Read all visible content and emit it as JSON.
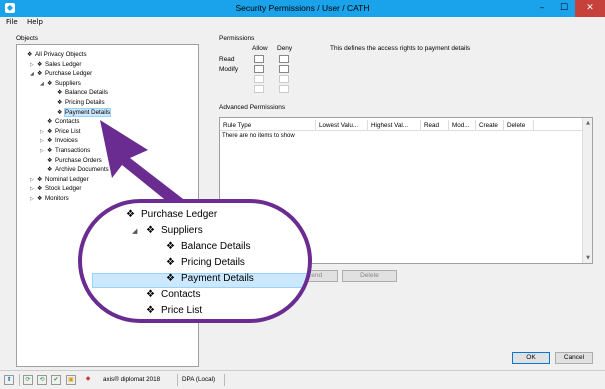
{
  "window": {
    "title": "Security Permissions / User / CATH",
    "app_icon": "axis-icon"
  },
  "menu": {
    "items": [
      "File",
      "Help"
    ]
  },
  "objects": {
    "label": "Objects",
    "tree": [
      {
        "label": "All Privacy Objects",
        "depth": 0,
        "expander": ""
      },
      {
        "label": "Sales Ledger",
        "depth": 1,
        "expander": "▷"
      },
      {
        "label": "Purchase Ledger",
        "depth": 1,
        "expander": "◢"
      },
      {
        "label": "Suppliers",
        "depth": 2,
        "expander": "◢"
      },
      {
        "label": "Balance Details",
        "depth": 3,
        "expander": ""
      },
      {
        "label": "Pricing Details",
        "depth": 3,
        "expander": ""
      },
      {
        "label": "Payment Details",
        "depth": 3,
        "expander": "",
        "selected": true
      },
      {
        "label": "Contacts",
        "depth": 2,
        "expander": ""
      },
      {
        "label": "Price List",
        "depth": 2,
        "expander": "▷"
      },
      {
        "label": "Invoices",
        "depth": 2,
        "expander": "▷"
      },
      {
        "label": "Transactions",
        "depth": 2,
        "expander": "▷"
      },
      {
        "label": "Purchase Orders",
        "depth": 2,
        "expander": ""
      },
      {
        "label": "Archive Documents",
        "depth": 2,
        "expander": ""
      },
      {
        "label": "Nominal Ledger",
        "depth": 1,
        "expander": "▷"
      },
      {
        "label": "Stock Ledger",
        "depth": 1,
        "expander": "▷"
      },
      {
        "label": "Monitors",
        "depth": 1,
        "expander": "▷"
      }
    ]
  },
  "permissions": {
    "label": "Permissions",
    "allow_header": "Allow",
    "deny_header": "Deny",
    "description": "This defines the access rights to payment details",
    "rows": [
      "Read",
      "Modify",
      "",
      ""
    ]
  },
  "advanced": {
    "label": "Advanced Permissions",
    "columns": [
      "Rule Type",
      "Lowest Valu...",
      "Highest Val...",
      "Read",
      "Mod...",
      "Create",
      "Delete"
    ],
    "empty_text": "There are no items to show",
    "buttons": {
      "append": "...end",
      "delete": "Delete"
    }
  },
  "footer": {
    "ok": "OK",
    "cancel": "Cancel"
  },
  "statusbar": {
    "product": "axis® diplomat 2018",
    "database": "DPA (Local)"
  },
  "zoom": {
    "items": [
      {
        "label": "Purchase Ledger",
        "depth": 0,
        "expander": ""
      },
      {
        "label": "Suppliers",
        "depth": 1,
        "expander": "◢"
      },
      {
        "label": "Balance Details",
        "depth": 2,
        "expander": ""
      },
      {
        "label": "Pricing Details",
        "depth": 2,
        "expander": ""
      },
      {
        "label": "Payment Details",
        "depth": 2,
        "expander": "",
        "selected": true
      },
      {
        "label": "Contacts",
        "depth": 1,
        "expander": ""
      },
      {
        "label": "Price List",
        "depth": 1,
        "expander": ""
      }
    ]
  },
  "colors": {
    "titlebar": "#1aa3ea",
    "close": "#c7413b",
    "annotation": "#6a2c91",
    "selection": "#cce8ff"
  }
}
